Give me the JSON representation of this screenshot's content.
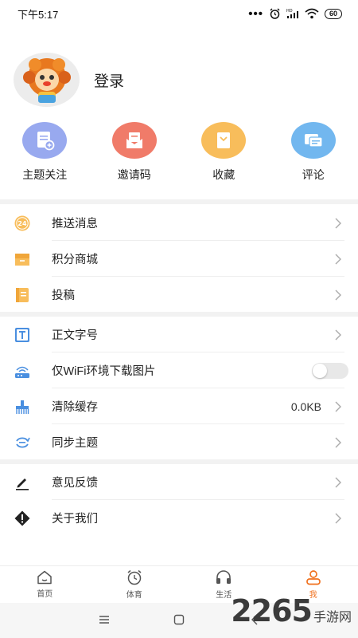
{
  "status_bar": {
    "time": "下午5:17",
    "dots": "•••",
    "battery": "60"
  },
  "profile": {
    "login_label": "登录"
  },
  "quick_actions": [
    {
      "label": "主题关注",
      "icon": "topic-follow-icon",
      "color": "#98a9ef"
    },
    {
      "label": "邀请码",
      "icon": "invite-mail-icon",
      "color": "#f07b69"
    },
    {
      "label": "收藏",
      "icon": "favorites-icon",
      "color": "#f8bd5b"
    },
    {
      "label": "评论",
      "icon": "comment-icon",
      "color": "#72b7ef"
    }
  ],
  "menu": {
    "group1": [
      {
        "label": "推送消息",
        "icon": "push-24-icon"
      },
      {
        "label": "积分商城",
        "icon": "points-mall-icon"
      },
      {
        "label": "投稿",
        "icon": "submit-article-icon"
      }
    ],
    "group2": [
      {
        "label": "正文字号",
        "icon": "font-size-icon"
      },
      {
        "label": "仅WiFi环境下载图片",
        "icon": "wifi-router-icon",
        "toggle_on": false
      },
      {
        "label": "清除缓存",
        "icon": "clear-cache-icon",
        "value": "0.0KB"
      },
      {
        "label": "同步主题",
        "icon": "sync-icon"
      }
    ],
    "group3": [
      {
        "label": "意见反馈",
        "icon": "feedback-pen-icon"
      },
      {
        "label": "关于我们",
        "icon": "about-diamond-icon"
      }
    ]
  },
  "tabs": [
    {
      "label": "首页",
      "icon": "home-icon",
      "active": false
    },
    {
      "label": "体育",
      "icon": "alarm-clock-icon",
      "active": false
    },
    {
      "label": "生活",
      "icon": "headphones-icon",
      "active": false
    },
    {
      "label": "我",
      "icon": "person-icon",
      "active": true
    }
  ],
  "colors": {
    "accent": "#f0711f",
    "separator": "#f2f2f2"
  },
  "watermark": {
    "number": "2265",
    "text": "手游网"
  }
}
